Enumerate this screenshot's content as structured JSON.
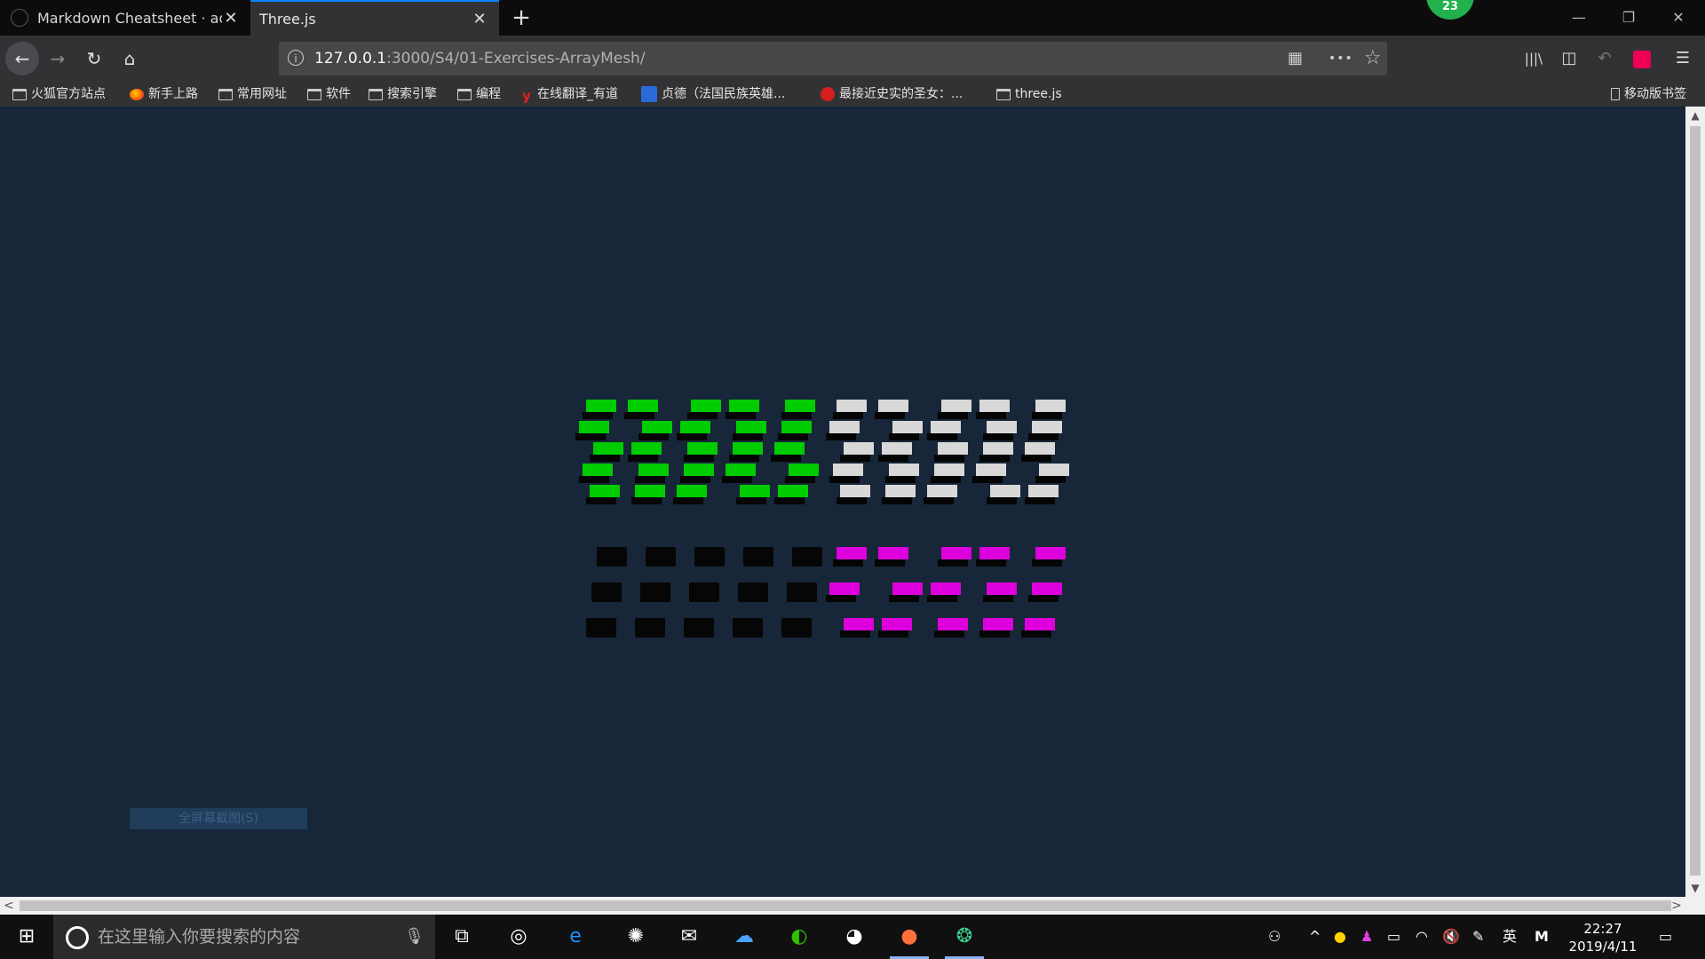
{
  "tabs": [
    {
      "title": "Markdown Cheatsheet · adam",
      "close": "✕",
      "active": false
    },
    {
      "title": "Three.js",
      "close": "✕",
      "active": true
    }
  ],
  "new_tab": "+",
  "profile_badge": "23",
  "window_controls": {
    "minimize": "—",
    "restore": "❐",
    "close": "✕"
  },
  "nav": {
    "back": "←",
    "forward": "→",
    "reload": "↻",
    "home": "⌂"
  },
  "url": {
    "host": "127.0.0.1",
    "path": ":3000/S4/01-Exercises-ArrayMesh/",
    "info": "i"
  },
  "url_icons": {
    "qr": "▦",
    "more": "•••",
    "star": "☆"
  },
  "toolbar_icons": {
    "library": "|||\\",
    "sidebar": "◫",
    "undo": "↶",
    "menu": "☰"
  },
  "bookmarks": [
    {
      "label": "火狐官方站点",
      "icon": "folder"
    },
    {
      "label": "新手上路",
      "icon": "firefox"
    },
    {
      "label": "常用网址",
      "icon": "folder"
    },
    {
      "label": "软件",
      "icon": "folder"
    },
    {
      "label": "搜索引擎",
      "icon": "folder"
    },
    {
      "label": "编程",
      "icon": "folder"
    },
    {
      "label": "在线翻译_有道",
      "icon": "youdao"
    },
    {
      "label": "贞德（法国民族英雄...",
      "icon": "baidu"
    },
    {
      "label": "最接近史实的圣女：...",
      "icon": "weibo"
    },
    {
      "label": "three.js",
      "icon": "folder"
    }
  ],
  "mobile_bookmarks": "移动版书签",
  "capture_tip": "全屏幕截图(S)",
  "scene": {
    "colors": {
      "green": "#00cc00",
      "white": "#d8d8d8",
      "magenta": "#dd00dd",
      "black": "#050505",
      "background": "#172638"
    },
    "quadrants": [
      {
        "name": "top-left",
        "color": "green",
        "columns": 5,
        "rows": 5
      },
      {
        "name": "top-right",
        "color": "white",
        "columns": 5,
        "rows": 5
      },
      {
        "name": "bottom-left",
        "color": "black",
        "columns": 5,
        "rows": 3
      },
      {
        "name": "bottom-right",
        "color": "magenta",
        "columns": 5,
        "rows": 3
      }
    ]
  },
  "taskbar": {
    "search_placeholder": "在这里输入你要搜索的内容",
    "time": "22:27",
    "date": "2019/4/11",
    "ime": "英",
    "ime2": "M"
  },
  "scroll_arrows": {
    "up": "▲",
    "down": "▼",
    "left": "<",
    "right": ">"
  }
}
